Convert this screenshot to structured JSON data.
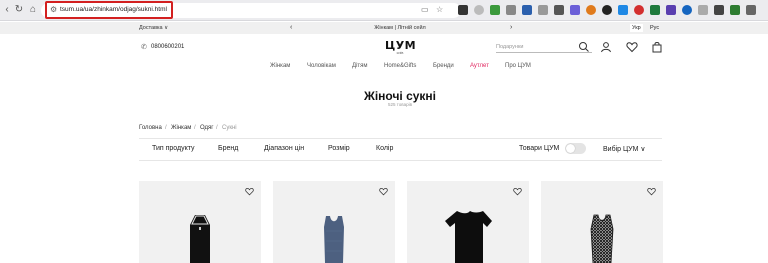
{
  "browser": {
    "url": "tsum.ua/ua/zhinkam/odjag/sukni.html",
    "colors": {
      "url_highlight": "#d32020"
    }
  },
  "topbar": {
    "dropdown_label": "Доставка ∨",
    "promo_text": "Жінкам | Літній сейл",
    "lang_ua": "Укр",
    "lang_ru": "Рус"
  },
  "header": {
    "phone": "0800600201",
    "logo_main": "ЦУМ",
    "logo_sub": "КИЇВ",
    "search_placeholder": "Подарунки"
  },
  "nav": {
    "items": [
      "Жінкам",
      "Чоловікам",
      "Дітям",
      "Home&Gifts",
      "Бренди",
      "Аутлет",
      "Про ЦУМ"
    ],
    "colors": {
      "outlet": "#e0245e"
    }
  },
  "page": {
    "title": "Жіночі сукні",
    "count": "525 товарів"
  },
  "breadcrumb": [
    "Головна",
    "Жінкам",
    "Одяг",
    "Сукні"
  ],
  "filters": {
    "items": [
      "Тип продукту",
      "Бренд",
      "Діапазон цін",
      "Розмір",
      "Колір"
    ],
    "tsum_goods_label": "Товари ЦУМ",
    "tsum_goods_on": false,
    "sort_label": "Вибір ЦУМ ∨"
  },
  "products": [
    {
      "icon": "black-halter-tank-dress",
      "color": "#111111"
    },
    {
      "icon": "blue-knit-tank-dress",
      "color": "#4d6080"
    },
    {
      "icon": "black-tshirt-dress",
      "color": "#0d0d0d"
    },
    {
      "icon": "black-crochet-dress",
      "color": "#1a1a1a"
    }
  ]
}
